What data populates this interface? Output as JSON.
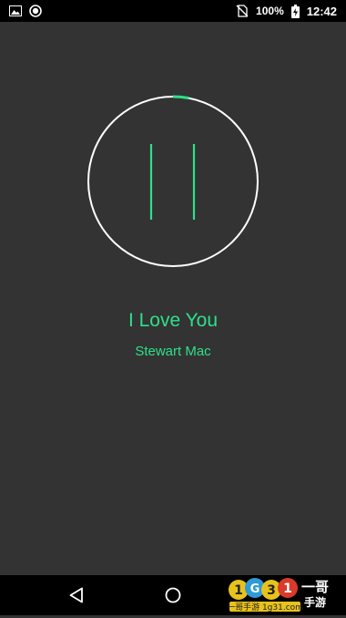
{
  "status_bar": {
    "battery_text": "100%",
    "time": "12:42",
    "icons": [
      "image-icon",
      "record-icon",
      "no-sim-icon",
      "battery-charging-icon"
    ]
  },
  "player": {
    "state": "playing",
    "control_icon": "pause-icon",
    "progress": 0.03,
    "accent_color": "#2ee08a",
    "ring_color": "#ffffff"
  },
  "track": {
    "title": "I Love You",
    "artist": "Stewart Mac"
  },
  "nav_bar": {
    "buttons": [
      "back-icon",
      "home-icon"
    ]
  },
  "watermark": {
    "text": "1g31 一哥手游 1g31.com"
  },
  "colors": {
    "background": "#333333",
    "bars": "#000000",
    "accent": "#2ee08a"
  }
}
